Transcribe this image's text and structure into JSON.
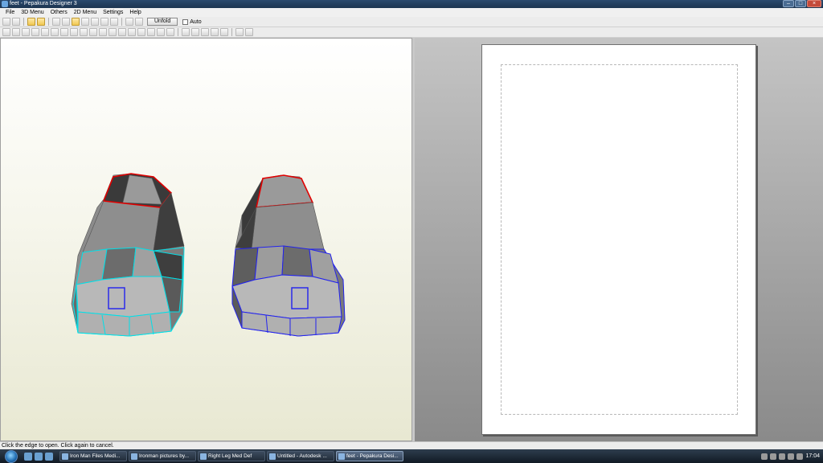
{
  "window": {
    "title": "feet - Pepakura Designer 3"
  },
  "menu": {
    "items": [
      "File",
      "3D Menu",
      "Others",
      "2D Menu",
      "Settings",
      "Help"
    ]
  },
  "toolbar": {
    "unfold_label": "Unfold",
    "auto_label": "Auto"
  },
  "status": {
    "text": "Click the edge to open. Click again to cancel."
  },
  "taskbar": {
    "items": [
      "Iron Man Files Medi...",
      "Ironman pictures by...",
      "Right Leg Med Def",
      "Untitled - Autodesk ...",
      "feet - Pepakura Desi..."
    ],
    "clock": "17:04"
  },
  "colors": {
    "cut_edge_red": "#e00000",
    "selected_cyan": "#00e0e8",
    "selected_blue": "#2222ee",
    "model_gray": "#8c8c8c"
  },
  "icons": [
    "open-icon",
    "save-icon",
    "view-icon",
    "texture-icon",
    "rotate-icon",
    "zoom-icon",
    "pan-icon",
    "select-icon",
    "anchor-icon",
    "edit-icon"
  ]
}
